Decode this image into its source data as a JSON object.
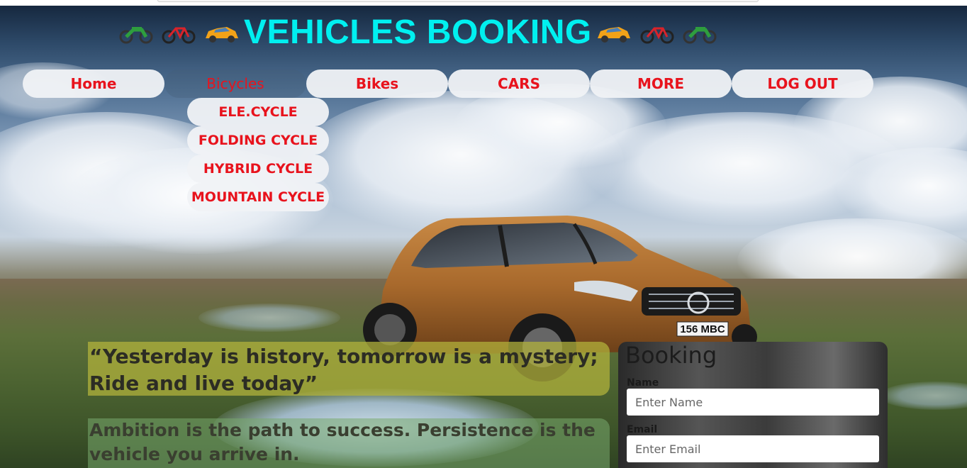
{
  "title": {
    "text": "VEHICLES BOOKING",
    "left_icons": [
      "motorcycle-icon",
      "bicycle-icon",
      "racecar-icon"
    ],
    "right_icons": [
      "racecar-icon",
      "bicycle-icon",
      "motorcycle-icon"
    ]
  },
  "nav": {
    "items": [
      {
        "label": "Home",
        "active": false
      },
      {
        "label": "Bicycles",
        "active": true
      },
      {
        "label": "Bikes",
        "active": false
      },
      {
        "label": "CARS",
        "active": false
      },
      {
        "label": "MORE",
        "active": false
      },
      {
        "label": "LOG OUT",
        "active": false
      }
    ],
    "dropdown": [
      "ELE.CYCLE",
      "FOLDING CYCLE",
      "HYBRID CYCLE",
      "MOUNTAIN CYCLE"
    ]
  },
  "car": {
    "plate": "156 MBC"
  },
  "quotes": {
    "q1_line1": "“Yesterday is history, tomorrow is a mystery;",
    "q1_line2": "Ride and live today”",
    "q2_line1": "Ambition is the path to success. Persistence is the",
    "q2_line2": "vehicle you arrive in."
  },
  "booking": {
    "heading": "Booking",
    "name_label": "Name",
    "name_placeholder": "Enter Name",
    "email_label": "Email",
    "email_placeholder": "Enter Email"
  },
  "colors": {
    "title": "#00f0f0",
    "nav_text": "#e8131d",
    "pill_bg": "#f0f2f5"
  }
}
